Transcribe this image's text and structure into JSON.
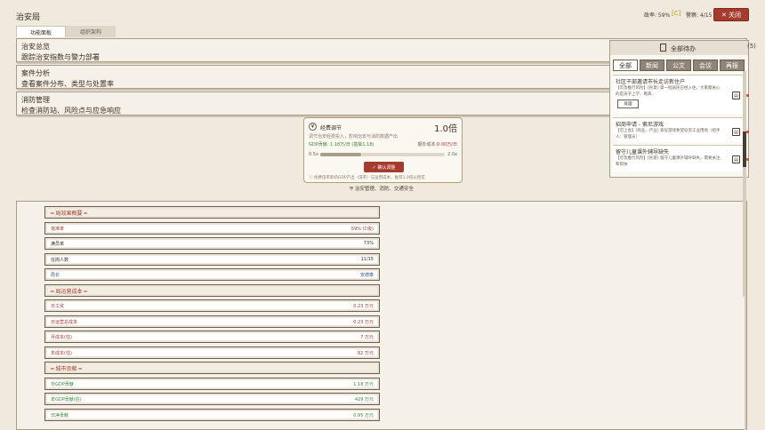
{
  "header": {
    "title": "治安局",
    "approval": "政率: 59%",
    "approval_mark": "[C]",
    "police": "警察: 4/15",
    "close_label": "✕ 关闭"
  },
  "tabs": [
    {
      "label": "功能面板",
      "active": true
    },
    {
      "label": "组织架构",
      "active": false
    }
  ],
  "sections": [
    {
      "title": "治安总览",
      "subtitle": "跟踪治安指数与警力部署"
    },
    {
      "title": "案件分析",
      "subtitle": "查看案件分布、类型与处置率"
    },
    {
      "title": "消防管理",
      "subtitle": "检查消防站、风险点与应急响应"
    }
  ],
  "budget": {
    "title": "经费调节",
    "multiplier": "1.0倍",
    "desc": "调节治安经费投入，影响治安与消防数据产出",
    "gdp": "GDP贡献: 1.18万/日 (基础1.18)",
    "extra_cost_label": "额外成本:",
    "extra_cost_value": "0.00万/日",
    "min": "0.5x",
    "max": "2.0x",
    "level": 0.33,
    "confirm_label": "✓ 确认调整",
    "note": "经费倍率影响GDP产出（倍率）与运营成本，推荐1.0倍以稳定",
    "scope": "治安管理、消防、交通安全"
  },
  "stats": [
    {
      "type": "header",
      "label": "━ 局效果概要 ━"
    },
    {
      "label": "批准率",
      "value": "59% (C级)",
      "color": "red"
    },
    {
      "label": "满员率",
      "value": "73%",
      "color": "dark"
    },
    {
      "label": "在岗人数",
      "value": "11/15",
      "color": "dark"
    },
    {
      "label": "局长",
      "value": "安德泰",
      "color": "blue"
    },
    {
      "type": "header",
      "label": "━ 局运营成本 ━"
    },
    {
      "label": "日工资",
      "value": "0.23 万元",
      "color": "red"
    },
    {
      "label": "日运营总成本",
      "value": "0.23 万元",
      "color": "red"
    },
    {
      "label": "月成本(估)",
      "value": "7 万元",
      "color": "red"
    },
    {
      "label": "年成本(估)",
      "value": "82 万元",
      "color": "red"
    },
    {
      "type": "header",
      "label": "━ 城市贡献 ━"
    },
    {
      "label": "日GDP贡献",
      "value": "1.18 万元",
      "color": "green"
    },
    {
      "label": "年GDP贡献(估)",
      "value": "429 万元",
      "color": "green"
    },
    {
      "label": "日净贡献",
      "value": "0.95 万元",
      "color": "green"
    }
  ],
  "panel": {
    "title": "全部待办",
    "count": "(5)",
    "tabs": [
      {
        "label": "全部",
        "active": true
      },
      {
        "label": "新闻",
        "active": false
      },
      {
        "label": "公文",
        "active": false
      },
      {
        "label": "会议",
        "active": false
      },
      {
        "label": "再报",
        "active": false
      }
    ],
    "items": [
      {
        "title": "社区干部邀请市长走访新住户",
        "desc": "【可急推行风险】[民意] 第一批居民已经入住，大家都关心的是孩子上学、看病...",
        "button": "处理"
      },
      {
        "title": "招商申请 - 索尼游戏",
        "desc": "【可上会】[商业、产业] 索尼游戏希望投资工业用地（招手人：管理员）"
      },
      {
        "title": "留守儿童课外辅导缺失",
        "desc": "【可急推行风险】[民意] 留守儿童课外辅导缺失，需要关注和帮扶"
      }
    ]
  }
}
